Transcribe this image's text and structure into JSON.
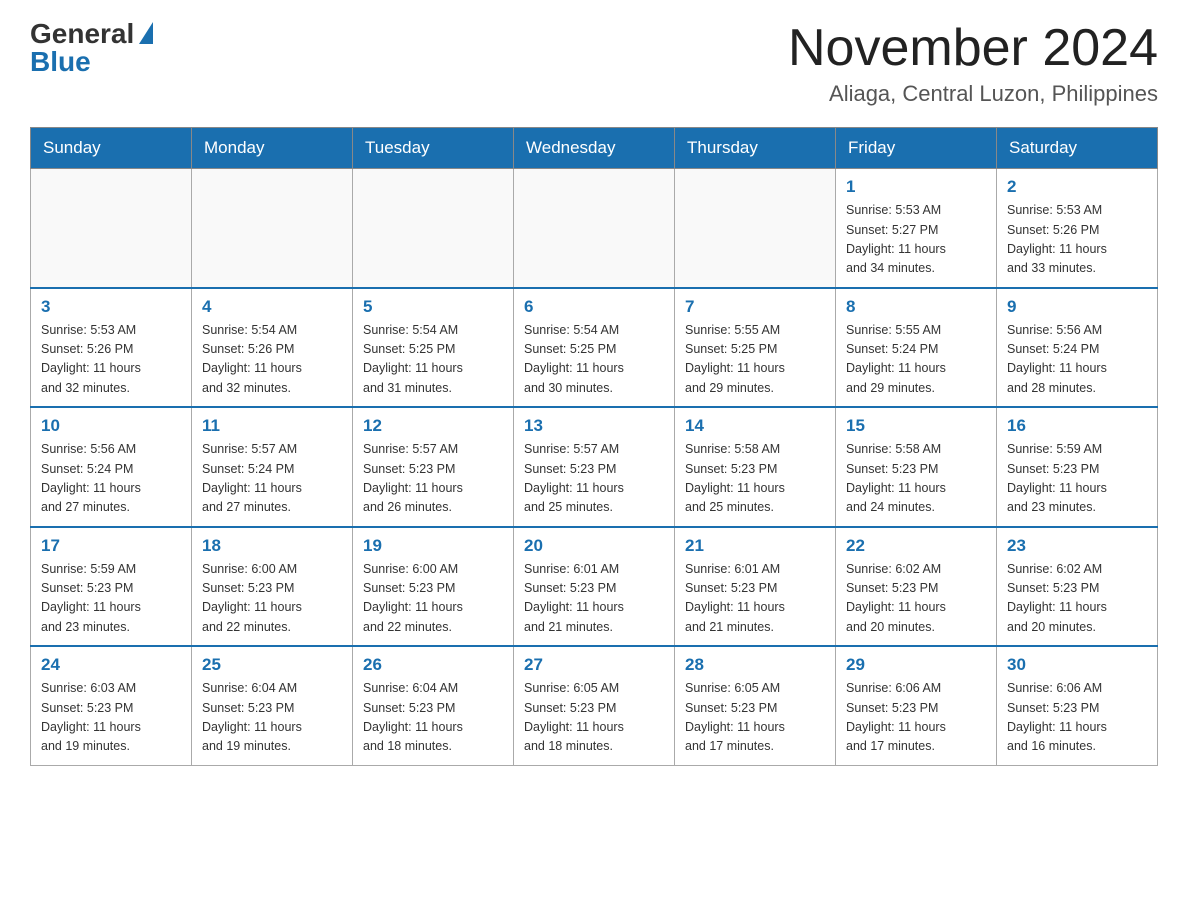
{
  "logo": {
    "general": "General",
    "blue": "Blue"
  },
  "title": "November 2024",
  "location": "Aliaga, Central Luzon, Philippines",
  "weekdays": [
    "Sunday",
    "Monday",
    "Tuesday",
    "Wednesday",
    "Thursday",
    "Friday",
    "Saturday"
  ],
  "weeks": [
    [
      {
        "day": "",
        "info": ""
      },
      {
        "day": "",
        "info": ""
      },
      {
        "day": "",
        "info": ""
      },
      {
        "day": "",
        "info": ""
      },
      {
        "day": "",
        "info": ""
      },
      {
        "day": "1",
        "info": "Sunrise: 5:53 AM\nSunset: 5:27 PM\nDaylight: 11 hours\nand 34 minutes."
      },
      {
        "day": "2",
        "info": "Sunrise: 5:53 AM\nSunset: 5:26 PM\nDaylight: 11 hours\nand 33 minutes."
      }
    ],
    [
      {
        "day": "3",
        "info": "Sunrise: 5:53 AM\nSunset: 5:26 PM\nDaylight: 11 hours\nand 32 minutes."
      },
      {
        "day": "4",
        "info": "Sunrise: 5:54 AM\nSunset: 5:26 PM\nDaylight: 11 hours\nand 32 minutes."
      },
      {
        "day": "5",
        "info": "Sunrise: 5:54 AM\nSunset: 5:25 PM\nDaylight: 11 hours\nand 31 minutes."
      },
      {
        "day": "6",
        "info": "Sunrise: 5:54 AM\nSunset: 5:25 PM\nDaylight: 11 hours\nand 30 minutes."
      },
      {
        "day": "7",
        "info": "Sunrise: 5:55 AM\nSunset: 5:25 PM\nDaylight: 11 hours\nand 29 minutes."
      },
      {
        "day": "8",
        "info": "Sunrise: 5:55 AM\nSunset: 5:24 PM\nDaylight: 11 hours\nand 29 minutes."
      },
      {
        "day": "9",
        "info": "Sunrise: 5:56 AM\nSunset: 5:24 PM\nDaylight: 11 hours\nand 28 minutes."
      }
    ],
    [
      {
        "day": "10",
        "info": "Sunrise: 5:56 AM\nSunset: 5:24 PM\nDaylight: 11 hours\nand 27 minutes."
      },
      {
        "day": "11",
        "info": "Sunrise: 5:57 AM\nSunset: 5:24 PM\nDaylight: 11 hours\nand 27 minutes."
      },
      {
        "day": "12",
        "info": "Sunrise: 5:57 AM\nSunset: 5:23 PM\nDaylight: 11 hours\nand 26 minutes."
      },
      {
        "day": "13",
        "info": "Sunrise: 5:57 AM\nSunset: 5:23 PM\nDaylight: 11 hours\nand 25 minutes."
      },
      {
        "day": "14",
        "info": "Sunrise: 5:58 AM\nSunset: 5:23 PM\nDaylight: 11 hours\nand 25 minutes."
      },
      {
        "day": "15",
        "info": "Sunrise: 5:58 AM\nSunset: 5:23 PM\nDaylight: 11 hours\nand 24 minutes."
      },
      {
        "day": "16",
        "info": "Sunrise: 5:59 AM\nSunset: 5:23 PM\nDaylight: 11 hours\nand 23 minutes."
      }
    ],
    [
      {
        "day": "17",
        "info": "Sunrise: 5:59 AM\nSunset: 5:23 PM\nDaylight: 11 hours\nand 23 minutes."
      },
      {
        "day": "18",
        "info": "Sunrise: 6:00 AM\nSunset: 5:23 PM\nDaylight: 11 hours\nand 22 minutes."
      },
      {
        "day": "19",
        "info": "Sunrise: 6:00 AM\nSunset: 5:23 PM\nDaylight: 11 hours\nand 22 minutes."
      },
      {
        "day": "20",
        "info": "Sunrise: 6:01 AM\nSunset: 5:23 PM\nDaylight: 11 hours\nand 21 minutes."
      },
      {
        "day": "21",
        "info": "Sunrise: 6:01 AM\nSunset: 5:23 PM\nDaylight: 11 hours\nand 21 minutes."
      },
      {
        "day": "22",
        "info": "Sunrise: 6:02 AM\nSunset: 5:23 PM\nDaylight: 11 hours\nand 20 minutes."
      },
      {
        "day": "23",
        "info": "Sunrise: 6:02 AM\nSunset: 5:23 PM\nDaylight: 11 hours\nand 20 minutes."
      }
    ],
    [
      {
        "day": "24",
        "info": "Sunrise: 6:03 AM\nSunset: 5:23 PM\nDaylight: 11 hours\nand 19 minutes."
      },
      {
        "day": "25",
        "info": "Sunrise: 6:04 AM\nSunset: 5:23 PM\nDaylight: 11 hours\nand 19 minutes."
      },
      {
        "day": "26",
        "info": "Sunrise: 6:04 AM\nSunset: 5:23 PM\nDaylight: 11 hours\nand 18 minutes."
      },
      {
        "day": "27",
        "info": "Sunrise: 6:05 AM\nSunset: 5:23 PM\nDaylight: 11 hours\nand 18 minutes."
      },
      {
        "day": "28",
        "info": "Sunrise: 6:05 AM\nSunset: 5:23 PM\nDaylight: 11 hours\nand 17 minutes."
      },
      {
        "day": "29",
        "info": "Sunrise: 6:06 AM\nSunset: 5:23 PM\nDaylight: 11 hours\nand 17 minutes."
      },
      {
        "day": "30",
        "info": "Sunrise: 6:06 AM\nSunset: 5:23 PM\nDaylight: 11 hours\nand 16 minutes."
      }
    ]
  ]
}
